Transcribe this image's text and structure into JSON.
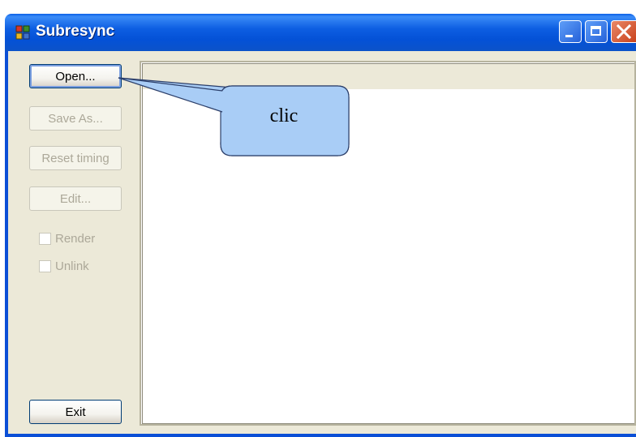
{
  "window": {
    "title": "Subresync"
  },
  "buttons": {
    "open": "Open...",
    "save_as": "Save As...",
    "reset_timing": "Reset timing",
    "edit": "Edit...",
    "exit": "Exit"
  },
  "checkboxes": {
    "render": "Render",
    "unlink": "Unlink"
  },
  "callout": {
    "text": "clic"
  },
  "colors": {
    "titlebar": "#0451d6",
    "client": "#ece9d8",
    "callout_fill": "#a9cdf6"
  }
}
